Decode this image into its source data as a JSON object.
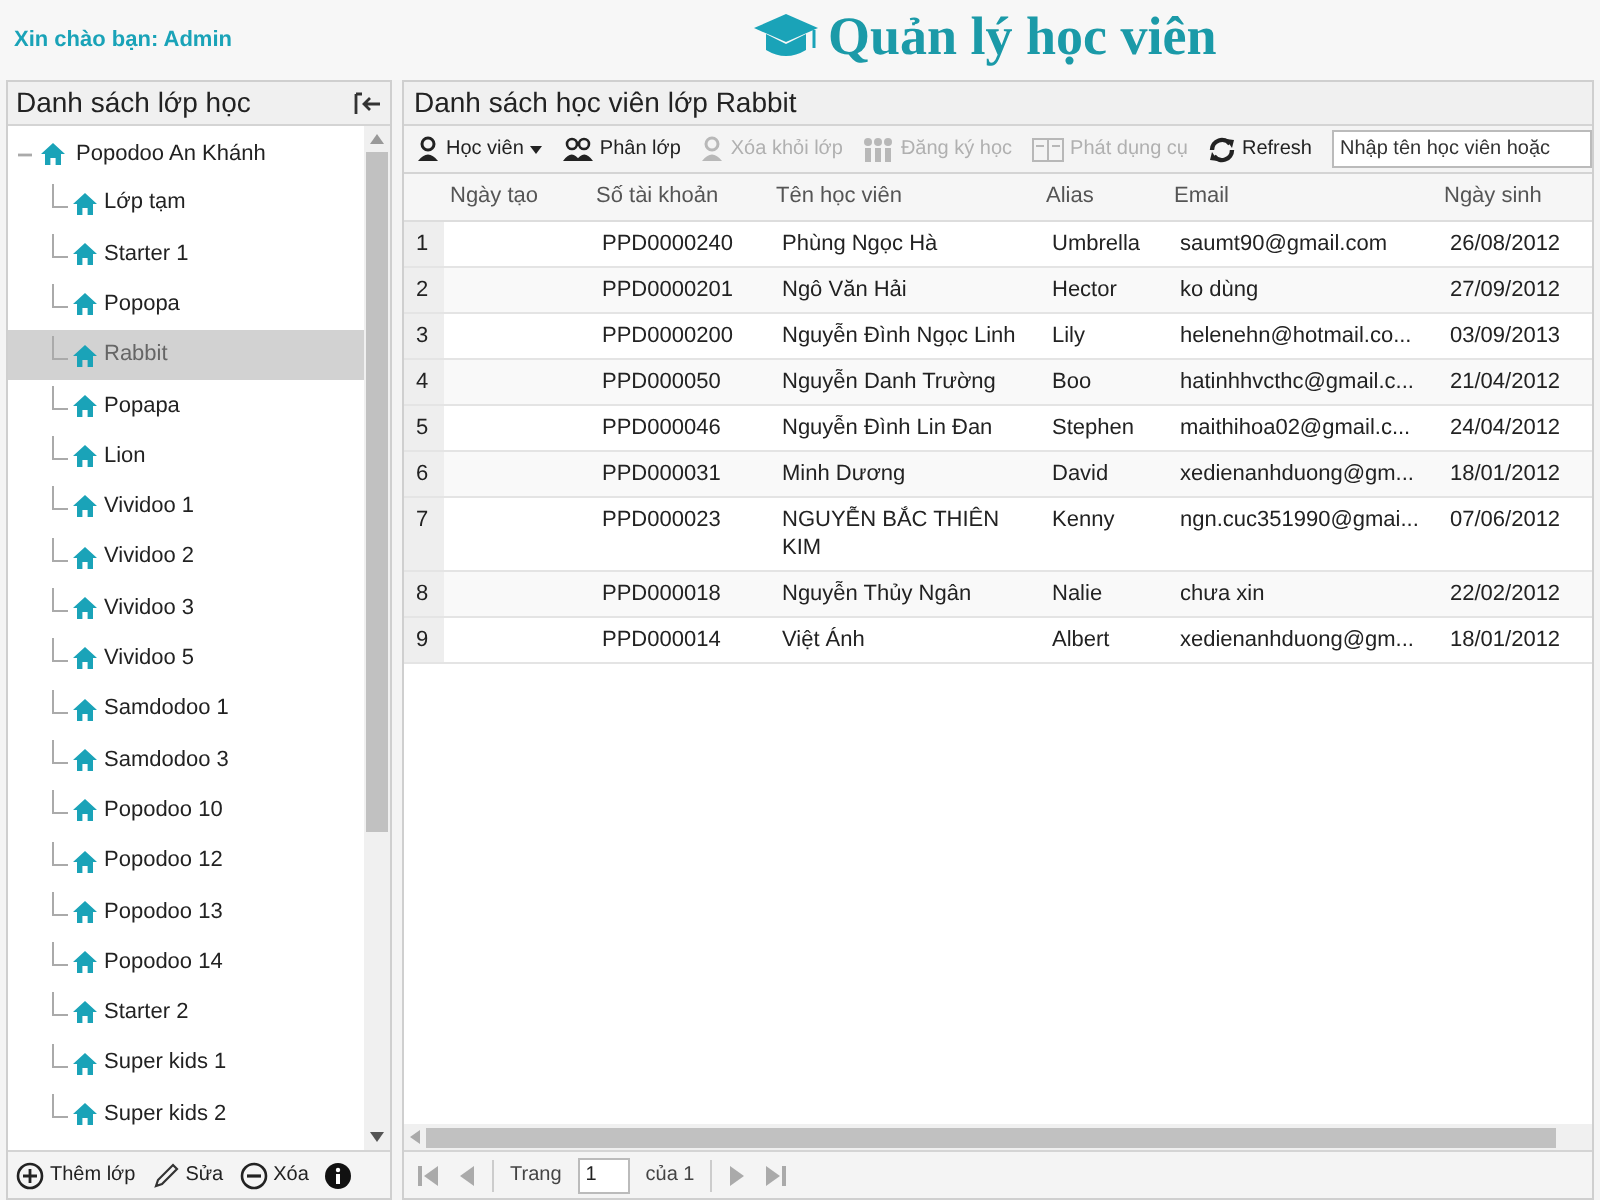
{
  "header": {
    "greeting": "Xin chào bạn: Admin",
    "title": "Quản lý học viên"
  },
  "sidebar": {
    "title": "Danh sách lớp học",
    "tree": [
      {
        "label": "Popodoo An Khánh",
        "expanded": true,
        "selected": false,
        "children": [
          {
            "label": "Lớp tạm",
            "selected": false
          },
          {
            "label": "Starter 1",
            "selected": false
          },
          {
            "label": "Popopa",
            "selected": false
          },
          {
            "label": "Rabbit",
            "selected": true
          },
          {
            "label": "Popapa",
            "selected": false
          },
          {
            "label": "Lion",
            "selected": false
          },
          {
            "label": "Vividoo 1",
            "selected": false
          },
          {
            "label": "Vividoo 2",
            "selected": false
          },
          {
            "label": "Vividoo 3",
            "selected": false
          },
          {
            "label": "Vividoo 5",
            "selected": false
          },
          {
            "label": "Samdodoo 1",
            "selected": false
          },
          {
            "label": "Samdodoo 3",
            "selected": false
          },
          {
            "label": "Popodoo 10",
            "selected": false
          },
          {
            "label": "Popodoo 12",
            "selected": false
          },
          {
            "label": "Popodoo 13",
            "selected": false
          },
          {
            "label": "Popodoo 14",
            "selected": false
          },
          {
            "label": "Starter 2",
            "selected": false
          },
          {
            "label": "Super kids 1",
            "selected": false
          },
          {
            "label": "Super kids 2",
            "selected": false
          }
        ]
      }
    ],
    "footer_buttons": [
      {
        "kind": "add",
        "label": "Thêm lớp"
      },
      {
        "kind": "edit",
        "label": "Sửa"
      },
      {
        "kind": "delete",
        "label": "Xóa"
      },
      {
        "kind": "info"
      }
    ]
  },
  "main": {
    "title": "Danh sách học viên lớp Rabbit",
    "toolbar": [
      {
        "kind": "student",
        "label": "Học viên",
        "disabled": false,
        "dropdown": true
      },
      {
        "kind": "assign",
        "label": "Phân lớp",
        "disabled": false,
        "dropdown": false
      },
      {
        "kind": "remove",
        "label": "Xóa khỏi lớp",
        "disabled": true,
        "dropdown": false
      },
      {
        "kind": "enroll",
        "label": "Đăng ký học",
        "disabled": true,
        "dropdown": false
      },
      {
        "kind": "book",
        "label": "Phát dụng cụ",
        "disabled": true,
        "dropdown": false
      },
      {
        "kind": "refresh",
        "label": "Refresh",
        "disabled": false,
        "dropdown": false
      }
    ],
    "search": {
      "placeholder": "Nhập tên học viên hoặc"
    },
    "table": {
      "columns": [
        "Ngày tạo",
        "Số tài khoản",
        "Tên học viên",
        "Alias",
        "Email",
        "Ngày sinh"
      ],
      "rows": [
        {
          "index": "1",
          "cells": [
            "",
            "PPD0000240",
            "Phùng Ngọc Hà",
            "Umbrella",
            "saumt90@gmail.com",
            "26/08/2012"
          ]
        },
        {
          "index": "2",
          "cells": [
            "",
            "PPD0000201",
            "Ngô Văn Hải",
            "Hector",
            "ko dùng",
            "27/09/2012"
          ]
        },
        {
          "index": "3",
          "cells": [
            "",
            "PPD0000200",
            "Nguyễn Đình Ngọc Linh",
            "Lily",
            "helenehn@hotmail.co...",
            "03/09/2013"
          ]
        },
        {
          "index": "4",
          "cells": [
            "",
            "PPD000050",
            "Nguyễn Danh Trường",
            "Boo",
            "hatinhhvcthc@gmail.c...",
            "21/04/2012"
          ]
        },
        {
          "index": "5",
          "cells": [
            "",
            "PPD000046",
            "Nguyễn Đình Lin Đan",
            "Stephen",
            "maithihoa02@gmail.c...",
            "24/04/2012"
          ]
        },
        {
          "index": "6",
          "cells": [
            "",
            "PPD000031",
            "Minh Dương",
            "David",
            "xedienanhduong@gm...",
            "18/01/2012"
          ]
        },
        {
          "index": "7",
          "cells": [
            "",
            "PPD000023",
            "NGUYỄN BẮC THIÊN KIM",
            "Kenny",
            "ngn.cuc351990@gmai...",
            "07/06/2012"
          ]
        },
        {
          "index": "8",
          "cells": [
            "",
            "PPD000018",
            "Nguyễn Thủy Ngân",
            "Nalie",
            "chưa xin",
            "22/02/2012"
          ]
        },
        {
          "index": "9",
          "cells": [
            "",
            "PPD000014",
            "Việt Ánh",
            "Albert",
            "xedienanhduong@gm...",
            "18/01/2012"
          ]
        }
      ]
    },
    "pager": {
      "page_label": "Trang",
      "page": "1",
      "of_label": "của 1"
    }
  }
}
